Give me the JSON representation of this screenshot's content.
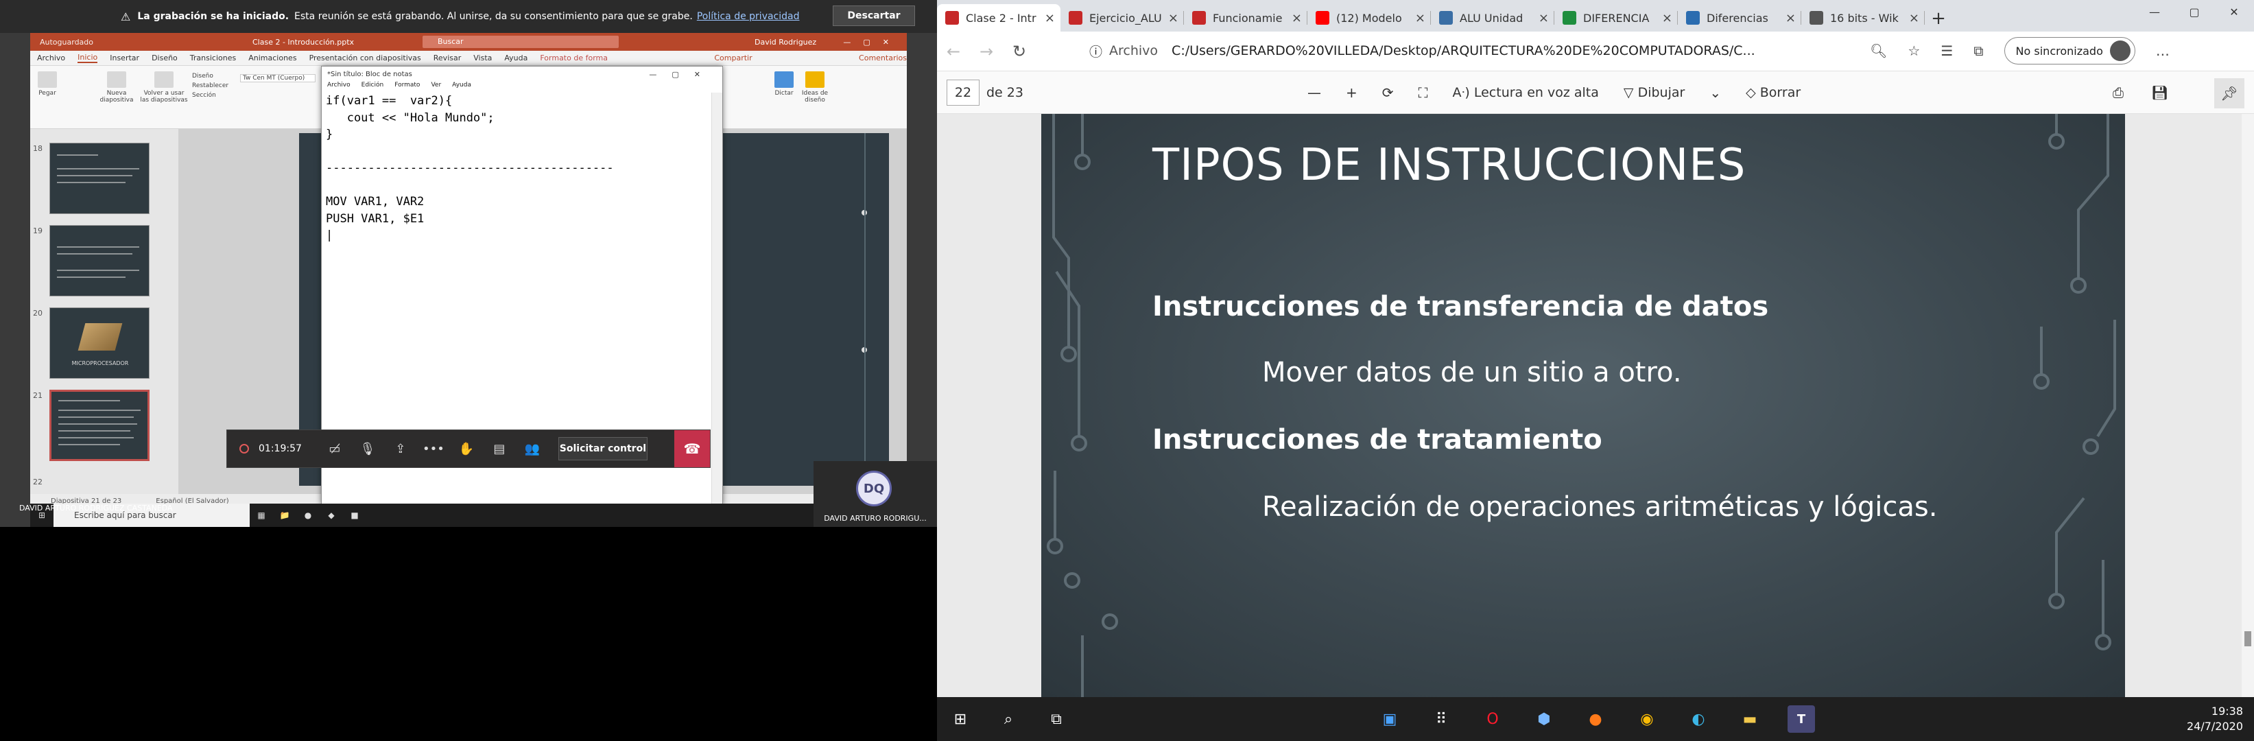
{
  "teams": {
    "recording": {
      "bold": "La grabación se ha iniciado.",
      "text": "Esta reunión se está grabando. Al unirse, da su consentimiento para que se grabe.",
      "link": "Política de privacidad",
      "discard": "Descartar"
    },
    "powerpoint": {
      "autosave": "Autoguardado",
      "doc_title": "Clase 2 - Introducción.pptx",
      "search_placeholder": "Buscar",
      "user": "David Rodriguez",
      "tabs": [
        "Archivo",
        "Inicio",
        "Insertar",
        "Diseño",
        "Transiciones",
        "Animaciones",
        "Presentación con diapositivas",
        "Revisar",
        "Vista",
        "Ayuda",
        "Formato de forma"
      ],
      "share": "Compartir",
      "comments": "Comentarios",
      "ribbon": {
        "paste": "Pegar",
        "new_slide": "Nueva diapositiva",
        "reuse": "Volver a usar las diapositivas",
        "layout": "Diseño",
        "reset": "Restablecer",
        "section": "Sección",
        "font": "Tw Cen MT (Cuerpo)",
        "dictate": "Dictar",
        "ideas": "Ideas de diseño"
      },
      "slide_numbers": [
        "18",
        "19",
        "20",
        "21",
        "22"
      ],
      "thumb_label_20": "MICROPROCESADOR",
      "status": {
        "slide": "Diapositiva 21 de 23",
        "lang": "Español (El Salvador)"
      }
    },
    "notepad": {
      "title": "*Sin título: Bloc de notas",
      "menu": [
        "Archivo",
        "Edición",
        "Formato",
        "Ver",
        "Ayuda"
      ],
      "text": "if(var1 ==  var2){\n   cout << \"Hola Mundo\";\n}\n\n-----------------------------------------\n\nMOV VAR1, VAR2\nPUSH VAR1, $E1\n|"
    },
    "meeting": {
      "timer": "01:19:57",
      "request_control": "Solicitar control"
    },
    "presenter": "DAVID ARTURO RODRIGUEZ CASTANEDA",
    "participant": {
      "initials": "DQ",
      "name": "DAVID ARTURO RODRIGU..."
    },
    "taskbar_search": "Escribe aquí para buscar"
  },
  "browser": {
    "tabs": [
      {
        "label": "Clase 2 - Intr",
        "icon": "pdf-icon",
        "color": "#c62828",
        "active": true
      },
      {
        "label": "Ejercicio_ALU",
        "icon": "pdf-icon",
        "color": "#c62828"
      },
      {
        "label": "Funcionamie",
        "icon": "pdf-icon",
        "color": "#c62828"
      },
      {
        "label": "(12) Modelo",
        "icon": "youtube-icon",
        "color": "#ff0000"
      },
      {
        "label": "ALU Unidad",
        "icon": "doc-icon",
        "color": "#3a6ea5"
      },
      {
        "label": "DIFERENCIA",
        "icon": "green-icon",
        "color": "#1e8e3e"
      },
      {
        "label": "Diferencias",
        "icon": "site-icon",
        "color": "#2b6cb0"
      },
      {
        "label": "16 bits - Wik",
        "icon": "wikipedia-icon",
        "color": "#555555"
      }
    ],
    "address_label": "Archivo",
    "url": "C:/Users/GERARDO%20VILLEDA/Desktop/ARQUITECTURA%20DE%20COMPUTADORAS/C...",
    "sync": "No sincronizado",
    "pdf": {
      "page": "22",
      "of": "de 23",
      "read_aloud": "Lectura en voz alta",
      "draw": "Dibujar",
      "erase": "Borrar"
    },
    "slide": {
      "title": "TIPOS DE INSTRUCCIONES",
      "items": [
        {
          "heading": "Instrucciones de transferencia de datos",
          "body": "Mover datos de un sitio a otro."
        },
        {
          "heading": "Instrucciones de tratamiento",
          "body": "Realización de operaciones aritméticas y lógicas."
        }
      ]
    },
    "clock": {
      "time": "19:38",
      "date": "24/7/2020"
    }
  }
}
